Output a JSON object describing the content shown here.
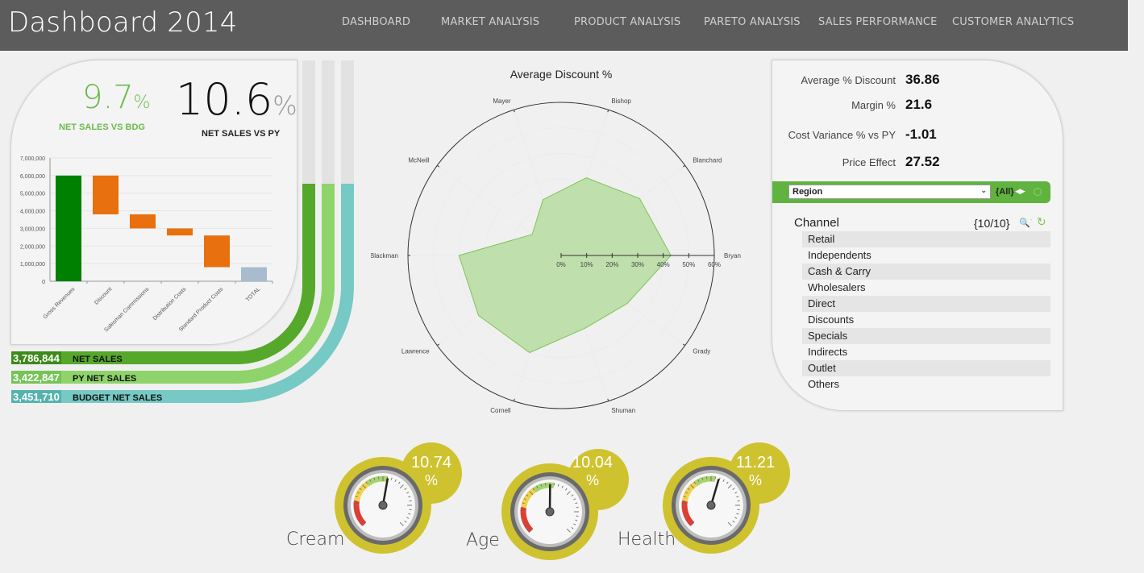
{
  "header": {
    "title": "Dashboard 2014",
    "nav": [
      "DASHBOARD",
      "MARKET ANALYSIS",
      "PRODUCT ANALYSIS",
      "PARETO ANALYSIS",
      "SALES PERFORMANCE",
      "CUSTOMER ANALYTICS"
    ]
  },
  "kpis": {
    "net_sales_vs_bdg": {
      "value": "9.7",
      "unit": "%",
      "label": "NET SALES VS BDG"
    },
    "net_sales_vs_py": {
      "value": "10.6",
      "unit": "%",
      "label": "NET SALES VS PY"
    }
  },
  "sales_bars": [
    {
      "value": "3,786,844",
      "label": "NET SALES"
    },
    {
      "value": "3,422,847",
      "label": "PY NET SALES"
    },
    {
      "value": "3,451,710",
      "label": "BUDGET NET SALES"
    }
  ],
  "metrics": [
    {
      "label": "Average % Discount",
      "value": "36.86"
    },
    {
      "label": "Margin %",
      "value": "21.6"
    },
    {
      "label": "Cost Variance % vs PY",
      "value": "-1.01"
    },
    {
      "label": "Price Effect",
      "value": "27.52"
    }
  ],
  "region_filter": {
    "selected": "Region",
    "all_label": "{All}"
  },
  "channel": {
    "title": "Channel",
    "count": "{10/10}",
    "items": [
      "Retail",
      "Independents",
      "Cash & Carry",
      "Wholesalers",
      "Direct",
      "Discounts",
      "Specials",
      "Indirects",
      "Outlet",
      "Others"
    ]
  },
  "gauges": [
    {
      "label": "Cream",
      "value": "10.74",
      "unit": "%"
    },
    {
      "label": "Age",
      "value": "10.04",
      "unit": "%"
    },
    {
      "label": "Health",
      "value": "11.21",
      "unit": "%"
    }
  ],
  "colors": {
    "header": "#5c5c5c",
    "net_sales": "#56a82b",
    "py_net_sales": "#8ed46b",
    "budget_net_sales": "#76c9c4",
    "waterfall_positive": "#008000",
    "waterfall_negative": "#e8700f",
    "waterfall_total": "#a9bccf",
    "radar_fill": "#9fd47f",
    "gauge_ring": "#cfc22f"
  },
  "chart_data": [
    {
      "type": "bar",
      "subtype": "waterfall",
      "categories": [
        "Gross Revenues",
        "Discount",
        "Salesman Commissions",
        "Distribution Costs",
        "Standard Product Costs",
        "TOTAL"
      ],
      "values": [
        6000000,
        -2200000,
        -800000,
        -400000,
        -1800000,
        800000
      ],
      "ylim": [
        0,
        7000000
      ],
      "yticks": [
        "0",
        "1,000,000",
        "2,000,000",
        "3,000,000",
        "4,000,000",
        "5,000,000",
        "6,000,000",
        "7,000,000"
      ],
      "grid": true
    },
    {
      "type": "radar",
      "title": "Average Discount %",
      "categories": [
        "Bryan",
        "Grady",
        "Shuman",
        "Cornell",
        "Lawrence",
        "Blackman",
        "McNeill",
        "Mayer",
        "Bishop",
        "Blanchard"
      ],
      "values": [
        43,
        32,
        30,
        40,
        40,
        40,
        14,
        23,
        32,
        38
      ],
      "rlim": [
        0,
        60
      ],
      "rticks": [
        "0%",
        "10%",
        "20%",
        "30%",
        "40%",
        "50%",
        "60%"
      ],
      "grid": true
    }
  ]
}
